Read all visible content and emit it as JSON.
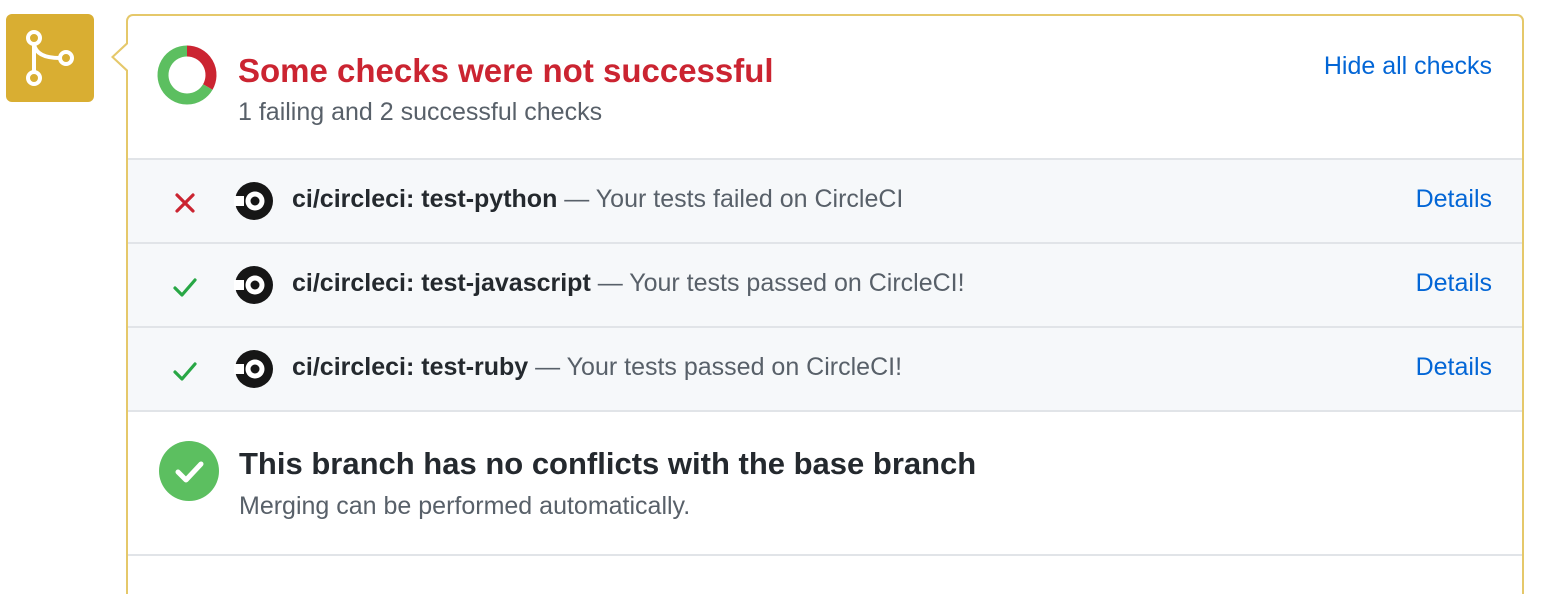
{
  "colors": {
    "badge": "#d9ae32",
    "panel_border": "#e5c86a",
    "failure": "#cb2431",
    "success": "#28a745",
    "success_icon_bg": "#5cbf60",
    "link": "#0366d6",
    "muted": "#586069",
    "row_bg": "#f6f8fa"
  },
  "badge": {
    "icon": "git-merge-icon"
  },
  "summary": {
    "donut": {
      "failing": 1,
      "successful": 2
    },
    "title": "Some checks were not successful",
    "subtitle": "1 failing and 2 successful checks",
    "toggle_label": "Hide all checks"
  },
  "checks": [
    {
      "status": "failure",
      "status_icon": "x-icon",
      "logo": "circleci-logo",
      "name": "ci/circleci: test-python",
      "description": " — Your tests failed on CircleCI",
      "details_label": "Details"
    },
    {
      "status": "success",
      "status_icon": "check-icon",
      "logo": "circleci-logo",
      "name": "ci/circleci: test-javascript",
      "description": " — Your tests passed on CircleCI!",
      "details_label": "Details"
    },
    {
      "status": "success",
      "status_icon": "check-icon",
      "logo": "circleci-logo",
      "name": "ci/circleci: test-ruby",
      "description": " — Your tests passed on CircleCI!",
      "details_label": "Details"
    }
  ],
  "merge": {
    "icon": "check-circle-icon",
    "title": "This branch has no conflicts with the base branch",
    "subtitle": "Merging can be performed automatically."
  }
}
